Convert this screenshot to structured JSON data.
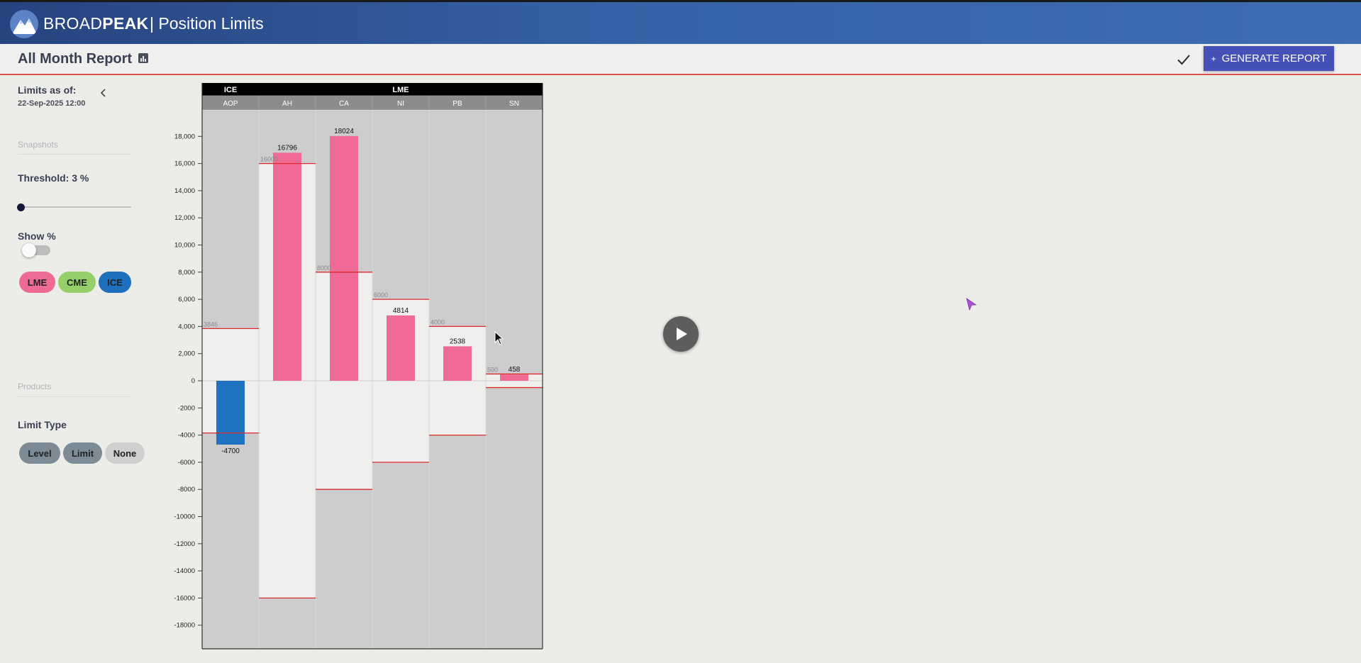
{
  "header": {
    "brand_light": "BROAD",
    "brand_bold": "PEAK",
    "app_title": "| Position Limits"
  },
  "toolbar": {
    "page_title": "All Month Report",
    "generate_label": "GENERATE REPORT"
  },
  "sidebar": {
    "limits_label": "Limits as of:",
    "limits_date": "22-Sep-2025 12:00",
    "snapshots_label": "Snapshots",
    "threshold_label": "Threshold: 3 %",
    "threshold_value": 3,
    "show_pct_label": "Show %",
    "show_pct_on": false,
    "exchange_chips": [
      {
        "label": "LME",
        "color": "#ee6b96"
      },
      {
        "label": "CME",
        "color": "#95cf6a"
      },
      {
        "label": "ICE",
        "color": "#1e6fbd"
      }
    ],
    "products_label": "Products",
    "limit_type_label": "Limit Type",
    "limit_type_chips": [
      {
        "label": "Level",
        "color": "#7c8b96"
      },
      {
        "label": "Limit",
        "color": "#7c8b96"
      },
      {
        "label": "None",
        "color": "#cfcfcf"
      }
    ]
  },
  "chart_data": {
    "type": "bar",
    "exchanges": [
      {
        "label": "ICE",
        "span": 1
      },
      {
        "label": "LME",
        "span": 5
      }
    ],
    "categories": [
      "AOP",
      "AH",
      "CA",
      "NI",
      "PB",
      "SN"
    ],
    "values": [
      -4700,
      16796,
      18024,
      4814,
      2538,
      458
    ],
    "value_labels": [
      "-4700",
      "16796",
      "18024",
      "4814",
      "2538",
      "458"
    ],
    "limits": [
      3846,
      16000,
      8000,
      6000,
      4000,
      500
    ],
    "limit_labels": [
      "3846",
      "16000",
      "8000",
      "6000",
      "4000",
      "500"
    ],
    "bar_colors": [
      "#1e72c0",
      "#ef6a95",
      "#ef6a95",
      "#ef6a95",
      "#ef6a95",
      "#ef6a95"
    ],
    "ylim": [
      -19500,
      19500
    ],
    "y_ticks": [
      {
        "v": 18000,
        "label": "18,000"
      },
      {
        "v": 16000,
        "label": "16,000"
      },
      {
        "v": 14000,
        "label": "14,000"
      },
      {
        "v": 12000,
        "label": "12,000"
      },
      {
        "v": 10000,
        "label": "10,000"
      },
      {
        "v": 8000,
        "label": "8,000"
      },
      {
        "v": 6000,
        "label": "6,000"
      },
      {
        "v": 4000,
        "label": "4,000"
      },
      {
        "v": 2000,
        "label": "2,000"
      },
      {
        "v": 0,
        "label": "0"
      },
      {
        "v": -2000,
        "label": "-2000"
      },
      {
        "v": -4000,
        "label": "-4000"
      },
      {
        "v": -6000,
        "label": "-6000"
      },
      {
        "v": -8000,
        "label": "-8000"
      },
      {
        "v": -10000,
        "label": "-10000"
      },
      {
        "v": -12000,
        "label": "-12000"
      },
      {
        "v": -14000,
        "label": "-14000"
      },
      {
        "v": -16000,
        "label": "-16000"
      },
      {
        "v": -18000,
        "label": "-18000"
      }
    ],
    "colors": {
      "limit_line": "#dd2a2a",
      "band": "#efefed",
      "column_bg": "#cdcdcd"
    }
  }
}
